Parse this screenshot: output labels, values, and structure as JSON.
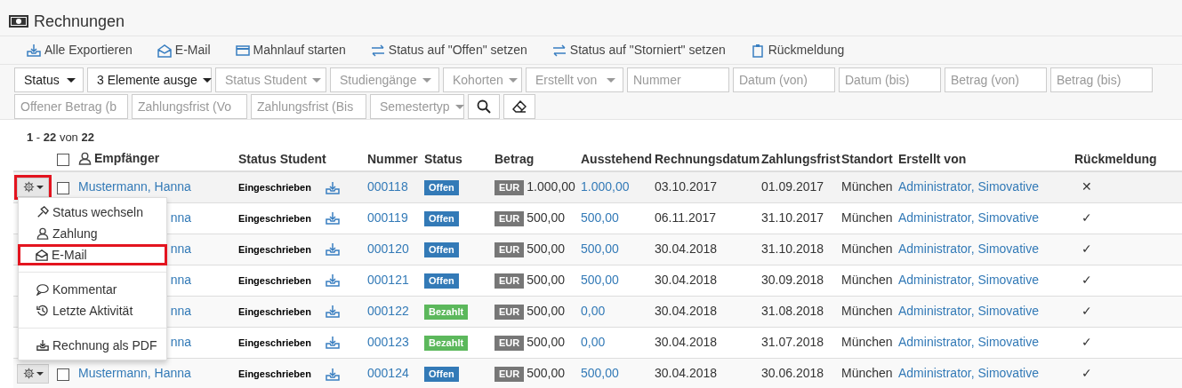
{
  "title": "Rechnungen",
  "toolbar": [
    {
      "label": "Alle Exportieren"
    },
    {
      "label": "E-Mail"
    },
    {
      "label": "Mahnlauf starten"
    },
    {
      "label": "Status auf \"Offen\" setzen"
    },
    {
      "label": "Status auf \"Storniert\" setzen"
    },
    {
      "label": "Rückmeldung"
    }
  ],
  "filters": [
    [
      {
        "kind": "select",
        "text": "Status",
        "filled": true
      },
      {
        "kind": "select",
        "text": "3 Elemente ausge",
        "filled": true
      },
      {
        "kind": "select",
        "text": "Status Student",
        "filled": false
      },
      {
        "kind": "select",
        "text": "Studiengänge",
        "filled": false
      },
      {
        "kind": "select",
        "text": "Kohorten",
        "filled": false
      },
      {
        "kind": "select",
        "text": "Erstellt von",
        "filled": false
      },
      {
        "kind": "input",
        "placeholder": "Nummer"
      },
      {
        "kind": "input",
        "placeholder": "Datum (von)"
      },
      {
        "kind": "input",
        "placeholder": "Datum (bis)"
      },
      {
        "kind": "input",
        "placeholder": "Betrag (von)"
      },
      {
        "kind": "input",
        "placeholder": "Betrag (bis)"
      }
    ],
    [
      {
        "kind": "input",
        "placeholder": "Offener Betrag (b"
      },
      {
        "kind": "input",
        "placeholder": "Zahlungsfrist (Vo"
      },
      {
        "kind": "input",
        "placeholder": "Zahlungsfrist (Bis"
      },
      {
        "kind": "select",
        "text": "Semestertyp",
        "filled": false
      },
      {
        "kind": "search"
      },
      {
        "kind": "clear"
      }
    ]
  ],
  "count": "**1** - **22** von **22**",
  "select_all": {
    "checked": false
  },
  "columns": [
    "Empfänger",
    "Status Student",
    "Nummer",
    "Status",
    "Betrag",
    "Ausstehend",
    "Rechnungsdatum",
    "Zahlungsfrist",
    "Standort",
    "Erstellt von",
    "Rückmeldung"
  ],
  "rows": [
    {
      "recipient": "Mustermann, Hanna",
      "covered": false,
      "selected": true,
      "checked": false,
      "status_student": "Eingeschrieben",
      "number": "000118",
      "status": {
        "label": "Offen",
        "kind": "open"
      },
      "currency": "EUR",
      "amount": "1.000,00",
      "outstanding": "1.000,00",
      "invoice_date": "03.10.2017",
      "due_date": "01.09.2017",
      "location": "München",
      "created_by": "Administrator, Simovative",
      "feedback": "✕"
    },
    {
      "recipient": "nna",
      "covered": true,
      "status_student": "Eingeschrieben",
      "number": "000119",
      "status": {
        "label": "Offen",
        "kind": "open"
      },
      "currency": "EUR",
      "amount": "500,00",
      "outstanding": "500,00",
      "invoice_date": "06.11.2017",
      "due_date": "31.10.2017",
      "location": "München",
      "created_by": "Administrator, Simovative",
      "feedback": "✓"
    },
    {
      "recipient": "nna",
      "covered": true,
      "status_student": "Eingeschrieben",
      "number": "000120",
      "status": {
        "label": "Offen",
        "kind": "open"
      },
      "currency": "EUR",
      "amount": "500,00",
      "outstanding": "500,00",
      "invoice_date": "30.04.2018",
      "due_date": "31.10.2018",
      "location": "München",
      "created_by": "Administrator, Simovative",
      "feedback": "✓"
    },
    {
      "recipient": "nna",
      "covered": true,
      "status_student": "Eingeschrieben",
      "number": "000121",
      "status": {
        "label": "Offen",
        "kind": "open"
      },
      "currency": "EUR",
      "amount": "500,00",
      "outstanding": "500,00",
      "invoice_date": "30.04.2018",
      "due_date": "30.09.2018",
      "location": "München",
      "created_by": "Administrator, Simovative",
      "feedback": "✓"
    },
    {
      "recipient": "nna",
      "covered": true,
      "status_student": "Eingeschrieben",
      "number": "000122",
      "status": {
        "label": "Bezahlt",
        "kind": "paid"
      },
      "currency": "EUR",
      "amount": "500,00",
      "outstanding": "0,00",
      "invoice_date": "30.04.2018",
      "due_date": "31.08.2018",
      "location": "München",
      "created_by": "Administrator, Simovative",
      "feedback": "✓"
    },
    {
      "recipient": "nna",
      "covered": true,
      "status_student": "Eingeschrieben",
      "number": "000123",
      "status": {
        "label": "Bezahlt",
        "kind": "paid"
      },
      "currency": "EUR",
      "amount": "500,00",
      "outstanding": "0,00",
      "invoice_date": "30.04.2018",
      "due_date": "31.07.2018",
      "location": "München",
      "created_by": "Administrator, Simovative",
      "feedback": "✓"
    },
    {
      "recipient": "Mustermann, Hanna",
      "covered": false,
      "selected": false,
      "checked": false,
      "status_student": "Eingeschrieben",
      "number": "000124",
      "status": {
        "label": "Offen",
        "kind": "open"
      },
      "currency": "EUR",
      "amount": "500,00",
      "outstanding": "500,00",
      "invoice_date": "30.04.2018",
      "due_date": "30.06.2018",
      "location": "München",
      "created_by": "Administrator, Simovative",
      "feedback": "✓"
    }
  ],
  "menu": [
    {
      "kind": "item",
      "label": "Status wechseln",
      "selected": false
    },
    {
      "kind": "item",
      "label": "Zahlung",
      "selected": false
    },
    {
      "kind": "item",
      "label": "E-Mail",
      "selected": true
    },
    {
      "kind": "divider"
    },
    {
      "kind": "item",
      "label": "Kommentar",
      "selected": false
    },
    {
      "kind": "item",
      "label": "Letzte Aktivität",
      "selected": false
    },
    {
      "kind": "divider"
    },
    {
      "kind": "item",
      "label": "Rechnung als PDF",
      "selected": false
    }
  ]
}
